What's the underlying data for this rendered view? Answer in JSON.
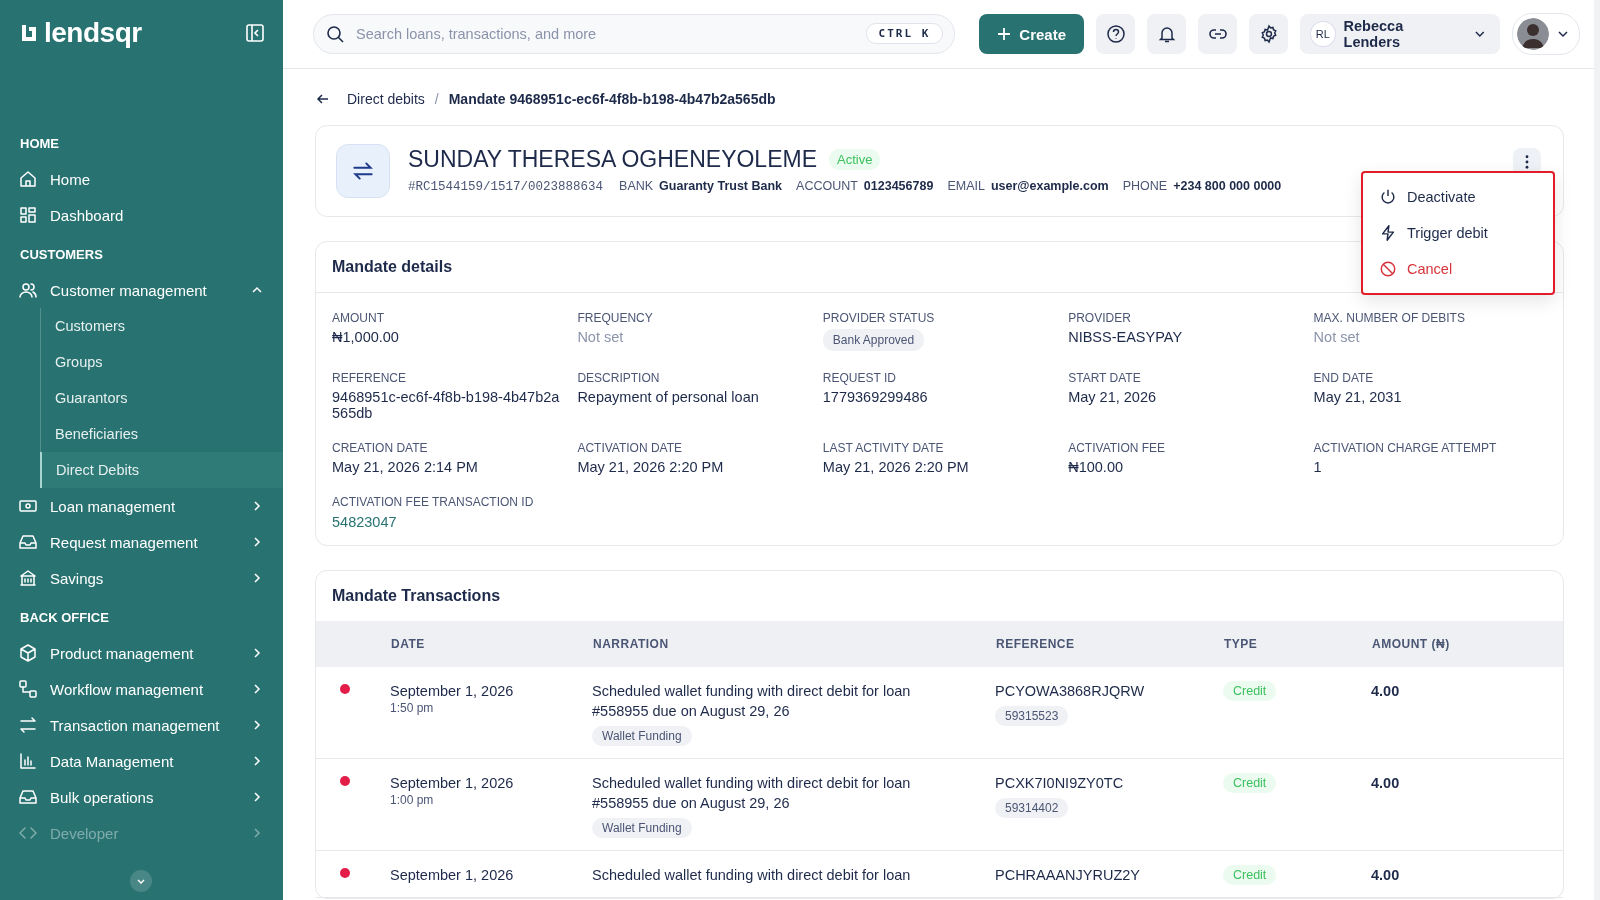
{
  "sidebar": {
    "logo": "lendsqr",
    "sections": [
      {
        "title": "HOME",
        "items": [
          {
            "label": "Home",
            "kind": "link"
          },
          {
            "label": "Dashboard",
            "kind": "link"
          }
        ]
      },
      {
        "title": "CUSTOMERS",
        "items": [
          {
            "label": "Customer management",
            "kind": "group",
            "expanded": true,
            "disabled": false,
            "children": [
              {
                "label": "Customers",
                "selected": false
              },
              {
                "label": "Groups",
                "selected": false
              },
              {
                "label": "Guarantors",
                "selected": false
              },
              {
                "label": "Beneficiaries",
                "selected": false
              },
              {
                "label": "Direct Debits",
                "selected": true
              }
            ]
          },
          {
            "label": "Loan management",
            "kind": "group",
            "expanded": false,
            "disabled": false
          },
          {
            "label": "Request management",
            "kind": "group",
            "expanded": false,
            "disabled": false
          },
          {
            "label": "Savings",
            "kind": "group",
            "expanded": false,
            "disabled": false
          }
        ]
      },
      {
        "title": "BACK OFFICE",
        "items": [
          {
            "label": "Product management",
            "kind": "group",
            "expanded": false,
            "disabled": false
          },
          {
            "label": "Workflow management",
            "kind": "group",
            "expanded": false,
            "disabled": false
          },
          {
            "label": "Transaction management",
            "kind": "group",
            "expanded": false,
            "disabled": false
          },
          {
            "label": "Data Management",
            "kind": "group",
            "expanded": false,
            "disabled": false
          },
          {
            "label": "Bulk operations",
            "kind": "group",
            "expanded": false,
            "disabled": false
          },
          {
            "label": "Developer",
            "kind": "group",
            "expanded": false,
            "disabled": true
          }
        ]
      }
    ]
  },
  "topbar": {
    "search": {
      "placeholder": "Search loans, transactions, and more",
      "shortcut": "CTRL K"
    },
    "create": "Create",
    "user": {
      "initials": "RL",
      "name": "Rebecca Lenders"
    }
  },
  "breadcrumb": {
    "parent": "Direct debits",
    "separator": "/",
    "current": "Mandate 9468951c-ec6f-4f8b-b198-4b47b2a565db"
  },
  "mandate": {
    "name": "SUNDAY THERESA OGHENEYOLEME",
    "status": "Active",
    "code": "#RC1544159/1517/0023888634",
    "meta": [
      {
        "label": "BANK",
        "value": "Guaranty Trust Bank"
      },
      {
        "label": "ACCOUNT",
        "value": "0123456789"
      },
      {
        "label": "EMAIL",
        "value": "user@example.com"
      },
      {
        "label": "PHONE",
        "value": "+234 800 000 0000"
      }
    ],
    "menu": [
      {
        "label": "Deactivate",
        "kind": "normal"
      },
      {
        "label": "Trigger debit",
        "kind": "normal"
      },
      {
        "label": "Cancel",
        "kind": "danger"
      }
    ]
  },
  "details": {
    "title": "Mandate details",
    "fields": [
      {
        "label": "AMOUNT",
        "value": "₦1,000.00",
        "kind": "text"
      },
      {
        "label": "FREQUENCY",
        "value": "Not set",
        "kind": "muted"
      },
      {
        "label": "PROVIDER STATUS",
        "value": "Bank Approved",
        "kind": "badge"
      },
      {
        "label": "PROVIDER",
        "value": "NIBSS-EASYPAY",
        "kind": "text"
      },
      {
        "label": "MAX. NUMBER OF DEBITS",
        "value": "Not set",
        "kind": "muted"
      },
      {
        "label": "REFERENCE",
        "value": "9468951c-ec6f-4f8b-b198-4b47b2a565db",
        "kind": "text"
      },
      {
        "label": "DESCRIPTION",
        "value": "Repayment of personal loan",
        "kind": "text"
      },
      {
        "label": "REQUEST ID",
        "value": "1779369299486",
        "kind": "text"
      },
      {
        "label": "START DATE",
        "value": "May 21, 2026",
        "kind": "text"
      },
      {
        "label": "END DATE",
        "value": "May 21, 2031",
        "kind": "text"
      },
      {
        "label": "CREATION DATE",
        "value": "May 21, 2026 2:14 PM",
        "kind": "text"
      },
      {
        "label": "ACTIVATION DATE",
        "value": "May 21, 2026 2:20 PM",
        "kind": "text"
      },
      {
        "label": "LAST ACTIVITY DATE",
        "value": "May 21, 2026 2:20 PM",
        "kind": "text"
      },
      {
        "label": "ACTIVATION FEE",
        "value": "₦100.00",
        "kind": "text"
      },
      {
        "label": "ACTIVATION CHARGE ATTEMPT",
        "value": "1",
        "kind": "text"
      },
      {
        "label": "ACTIVATION FEE TRANSACTION ID",
        "value": "54823047",
        "kind": "link"
      }
    ]
  },
  "transactions": {
    "title": "Mandate Transactions",
    "columns": [
      "DATE",
      "NARRATION",
      "REFERENCE",
      "TYPE",
      "AMOUNT (₦)"
    ],
    "rows": [
      {
        "color": "#e11d48",
        "date": "September 1, 2026",
        "time": "1:50 pm",
        "narration": "Scheduled wallet funding with direct debit for loan #558955 due on August 29, 26",
        "tag": "Wallet Funding",
        "reference": "PCYOWA3868RJQRW",
        "ref_id": "59315523",
        "type": "Credit",
        "amount": "4.00"
      },
      {
        "color": "#e11d48",
        "date": "September 1, 2026",
        "time": "1:00 pm",
        "narration": "Scheduled wallet funding with direct debit for loan #558955 due on August 29, 26",
        "tag": "Wallet Funding",
        "reference": "PCXK7I0NI9ZY0TC",
        "ref_id": "59314402",
        "type": "Credit",
        "amount": "4.00"
      },
      {
        "color": "#e11d48",
        "date": "September 1, 2026",
        "narration": "Scheduled wallet funding with direct debit for loan",
        "reference": "PCHRAAANJYRUZ2Y",
        "type": "Credit",
        "amount": "4.00"
      }
    ]
  }
}
